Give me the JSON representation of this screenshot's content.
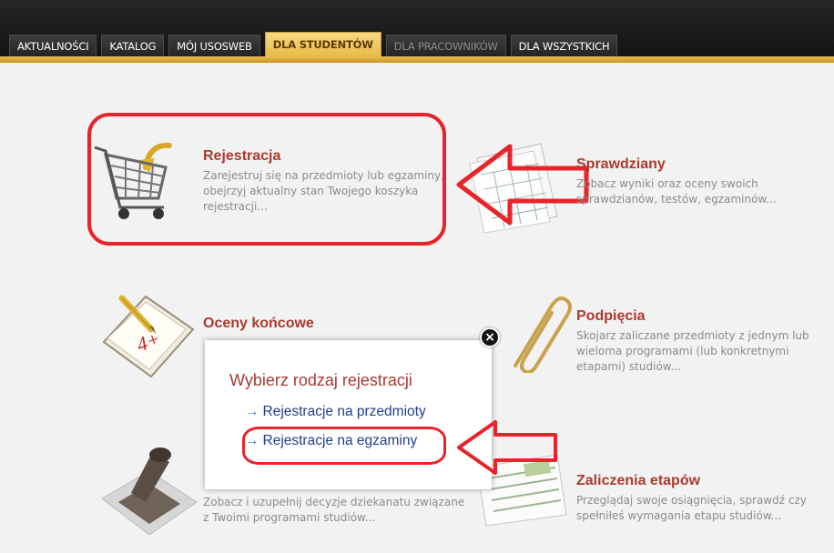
{
  "nav": {
    "tabs": [
      {
        "label": "AKTUALNOŚCI"
      },
      {
        "label": "KATALOG"
      },
      {
        "label": "MÓJ USOSWEB"
      },
      {
        "label": "DLA STUDENTÓW"
      },
      {
        "label": "DLA PRACOWNIKÓW"
      },
      {
        "label": "DLA WSZYSTKICH"
      }
    ],
    "active_tab": "DLA STUDENTÓW"
  },
  "sections": {
    "rejestracja": {
      "title": "Rejestracja",
      "desc": "Zarejestruj się na przedmioty lub egzaminy, obejrzyj aktualny stan Twojego koszyka rejestracji..."
    },
    "sprawdziany": {
      "title": "Sprawdziany",
      "desc": "Zobacz wyniki oraz oceny swoich sprawdzianów, testów, egzaminów..."
    },
    "oceny": {
      "title": "Oceny końcowe",
      "desc": ""
    },
    "podpiecia": {
      "title": "Podpięcia",
      "desc": "Skojarz zaliczane przedmioty z jednym lub wieloma programami (lub konkretnymi etapami) studiów..."
    },
    "decyzje": {
      "title": "",
      "desc": "Zobacz i uzupełnij decyzje dziekanatu związane z Twoimi programami studiów..."
    },
    "zaliczenia": {
      "title": "Zaliczenia etapów",
      "desc": "Przeglądaj swoje osiągnięcia, sprawdź czy spełniłeś wymagania etapu studiów..."
    }
  },
  "popup": {
    "title": "Wybierz rodzaj rejestracji",
    "link1": "Rejestracje na przedmioty",
    "link2": "Rejestracje na egzaminy",
    "close_icon": "×"
  },
  "icons": {
    "grade_text": "4+",
    "link_arrow": "→"
  },
  "colors": {
    "accent": "#e9bd50",
    "title_red": "#a93a2e",
    "annotation_red": "#e8232a",
    "link_blue": "#1f3e8c"
  }
}
